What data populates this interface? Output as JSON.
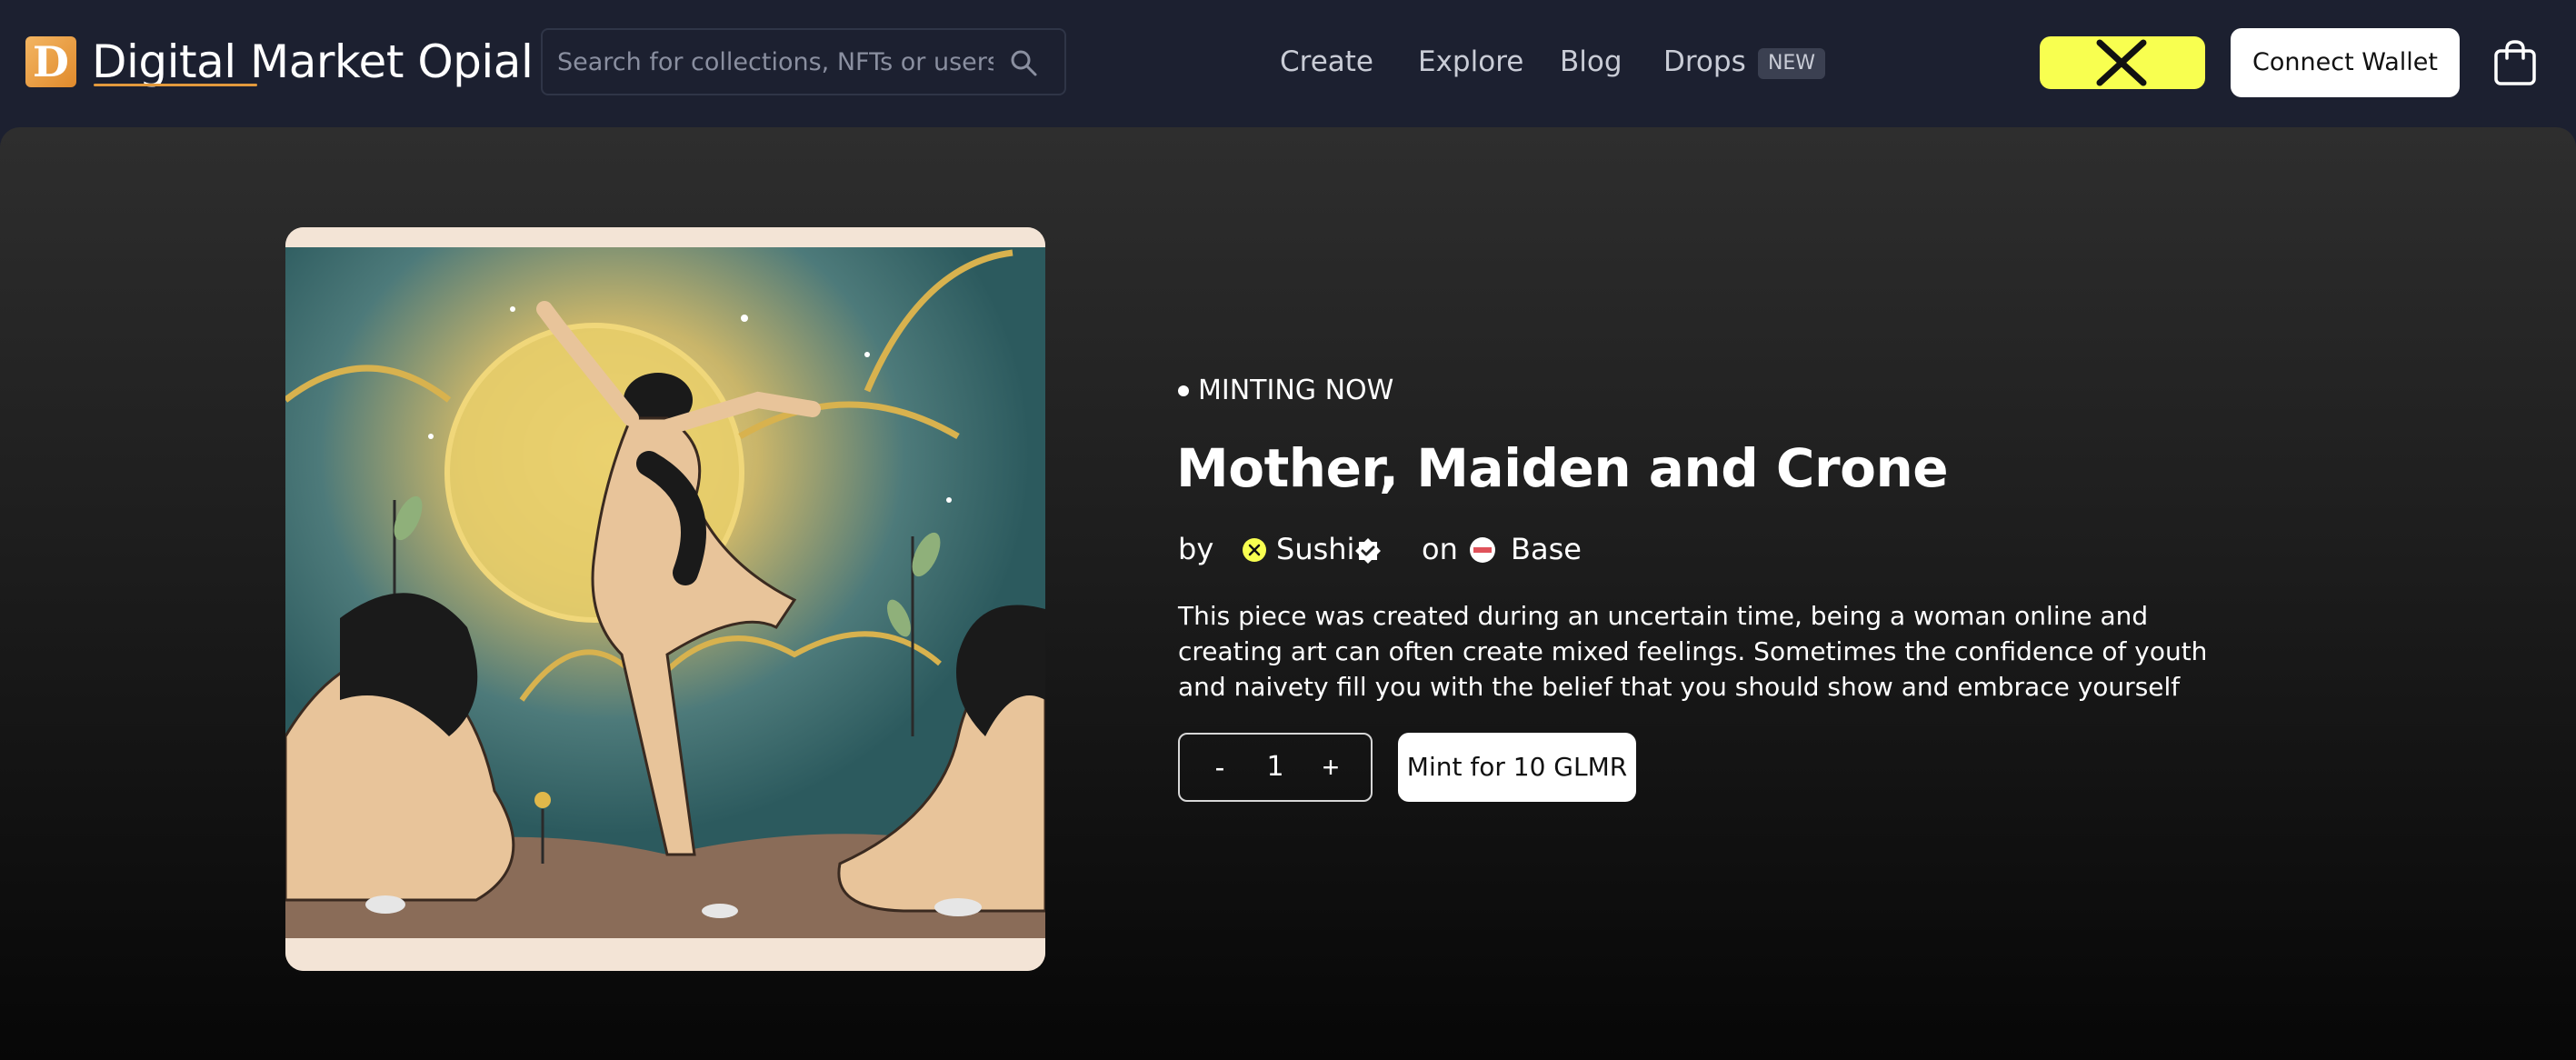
{
  "header": {
    "logo_letter": "D",
    "brand": "Digital Market Opial",
    "search": {
      "placeholder": "Search for collections, NFTs or users",
      "value": ""
    },
    "nav": [
      {
        "label": "Create"
      },
      {
        "label": "Explore"
      },
      {
        "label": "Blog"
      },
      {
        "label": "Drops",
        "badge": "NEW"
      }
    ],
    "connect_label": "Connect Wallet",
    "icons": {
      "search": "search-icon",
      "x": "x-logo-icon",
      "cart": "shopping-bag-icon"
    }
  },
  "drop": {
    "status": "MINTING NOW",
    "title": "Mother, Maiden and Crone",
    "by_label": "by",
    "creator": "Sushi",
    "on_label": "on",
    "chain": "Base",
    "description": "This piece was created during an uncertain time, being a woman online and creating art can often create mixed feelings. Sometimes the confidence of youth and naivety fill you with the belief that you should show and embrace yourself",
    "quantity": {
      "minus_label": "-",
      "value": "1",
      "plus_label": "+"
    },
    "mint_label": "Mint for 10 GLMR"
  },
  "colors": {
    "header_bg": "#1c2030",
    "accent_yellow": "#f8ff50",
    "logo_orange": "#e08a2c",
    "button_bg": "#ffffff"
  }
}
